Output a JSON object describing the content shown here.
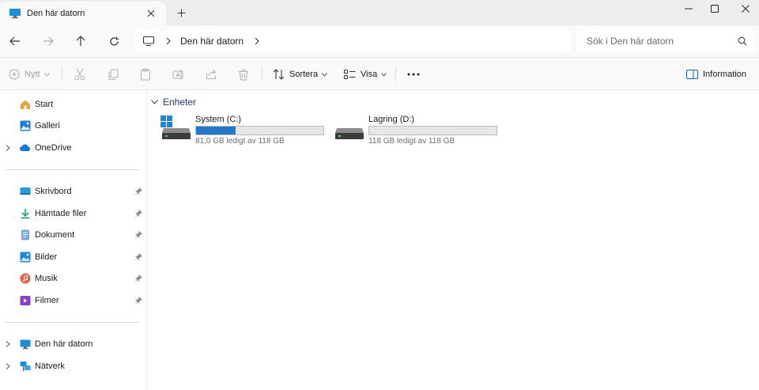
{
  "tab": {
    "title": "Den här datorn",
    "icon": "monitor-icon"
  },
  "window": {
    "controls": [
      "minimize",
      "maximize",
      "close"
    ]
  },
  "address": {
    "crumbs": [
      "Den här datorn"
    ]
  },
  "search": {
    "placeholder": "Sök i Den här datorn"
  },
  "commands": {
    "new_label": "Nytt",
    "sort_label": "Sortera",
    "view_label": "Visa",
    "info_label": "Information"
  },
  "sidebar": {
    "top": [
      {
        "label": "Start",
        "icon": "home-icon"
      },
      {
        "label": "Galleri",
        "icon": "gallery-icon"
      },
      {
        "label": "OneDrive",
        "icon": "cloud-icon"
      }
    ],
    "pinned": [
      {
        "label": "Skrivbord",
        "icon": "desktop-icon"
      },
      {
        "label": "Hämtade filer",
        "icon": "download-icon"
      },
      {
        "label": "Dokument",
        "icon": "document-icon"
      },
      {
        "label": "Bilder",
        "icon": "pictures-icon"
      },
      {
        "label": "Musik",
        "icon": "music-icon"
      },
      {
        "label": "Filmer",
        "icon": "video-icon"
      }
    ],
    "bottom": [
      {
        "label": "Den här datorn",
        "icon": "monitor-icon"
      },
      {
        "label": "Nätverk",
        "icon": "network-icon"
      }
    ]
  },
  "content": {
    "group_title": "Enheter",
    "drives": [
      {
        "name": "System (C:)",
        "free_text": "81,0 GB ledigt av 118 GB",
        "used_fraction": 0.31,
        "icon": "system-drive-icon"
      },
      {
        "name": "Lagring (D:)",
        "free_text": "118 GB ledigt av 118 GB",
        "used_fraction": 0.0,
        "icon": "drive-icon"
      }
    ]
  },
  "colors": {
    "accent": "#2677c8",
    "group_header": "#1e3a6e"
  }
}
